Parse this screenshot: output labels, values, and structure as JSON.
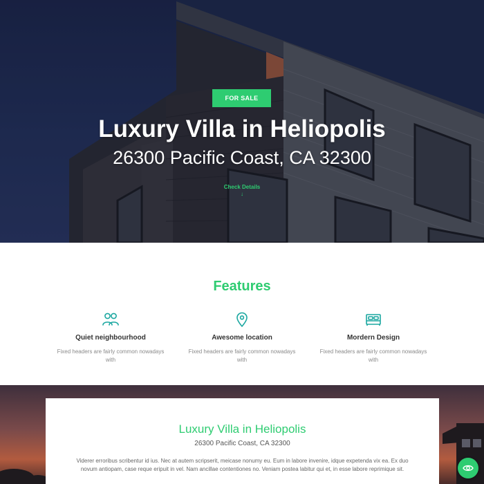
{
  "hero": {
    "badge": "FOR SALE",
    "title": "Luxury Villa in Heliopolis",
    "address": "26300 Pacific Coast, CA 32300",
    "cta": "Check Details",
    "cta_arrow": "↓"
  },
  "features": {
    "title": "Features",
    "items": [
      {
        "icon": "people-icon",
        "name": "Quiet neighbourhood",
        "desc": "Fixed headers are fairly common nowadays with"
      },
      {
        "icon": "location-pin-icon",
        "name": "Awesome location",
        "desc": "Fixed headers are fairly common nowadays with"
      },
      {
        "icon": "bed-icon",
        "name": "Mordern Design",
        "desc": "Fixed headers are fairly common nowadays with"
      }
    ]
  },
  "listing": {
    "title": "Luxury Villa in Heliopolis",
    "address": "26300 Pacific Coast, CA 32300",
    "body": "Viderer erroribus scribentur id ius. Nec at autem scripserit, meicase nonumy eu. Eum in labore invenire, idque expetenda vix ea. Ex duo novum antiopam, case reque eripuit in vel. Nam ancillae contentiones no. Veniam postea labitur qui et, in esse labore reprimique sit."
  },
  "floating": {
    "icon": "eye-icon"
  },
  "colors": {
    "accent": "#2ecc71",
    "hero_sky": "#1f2a50",
    "text_dark": "#333333",
    "text_muted": "#8a8a8a"
  }
}
